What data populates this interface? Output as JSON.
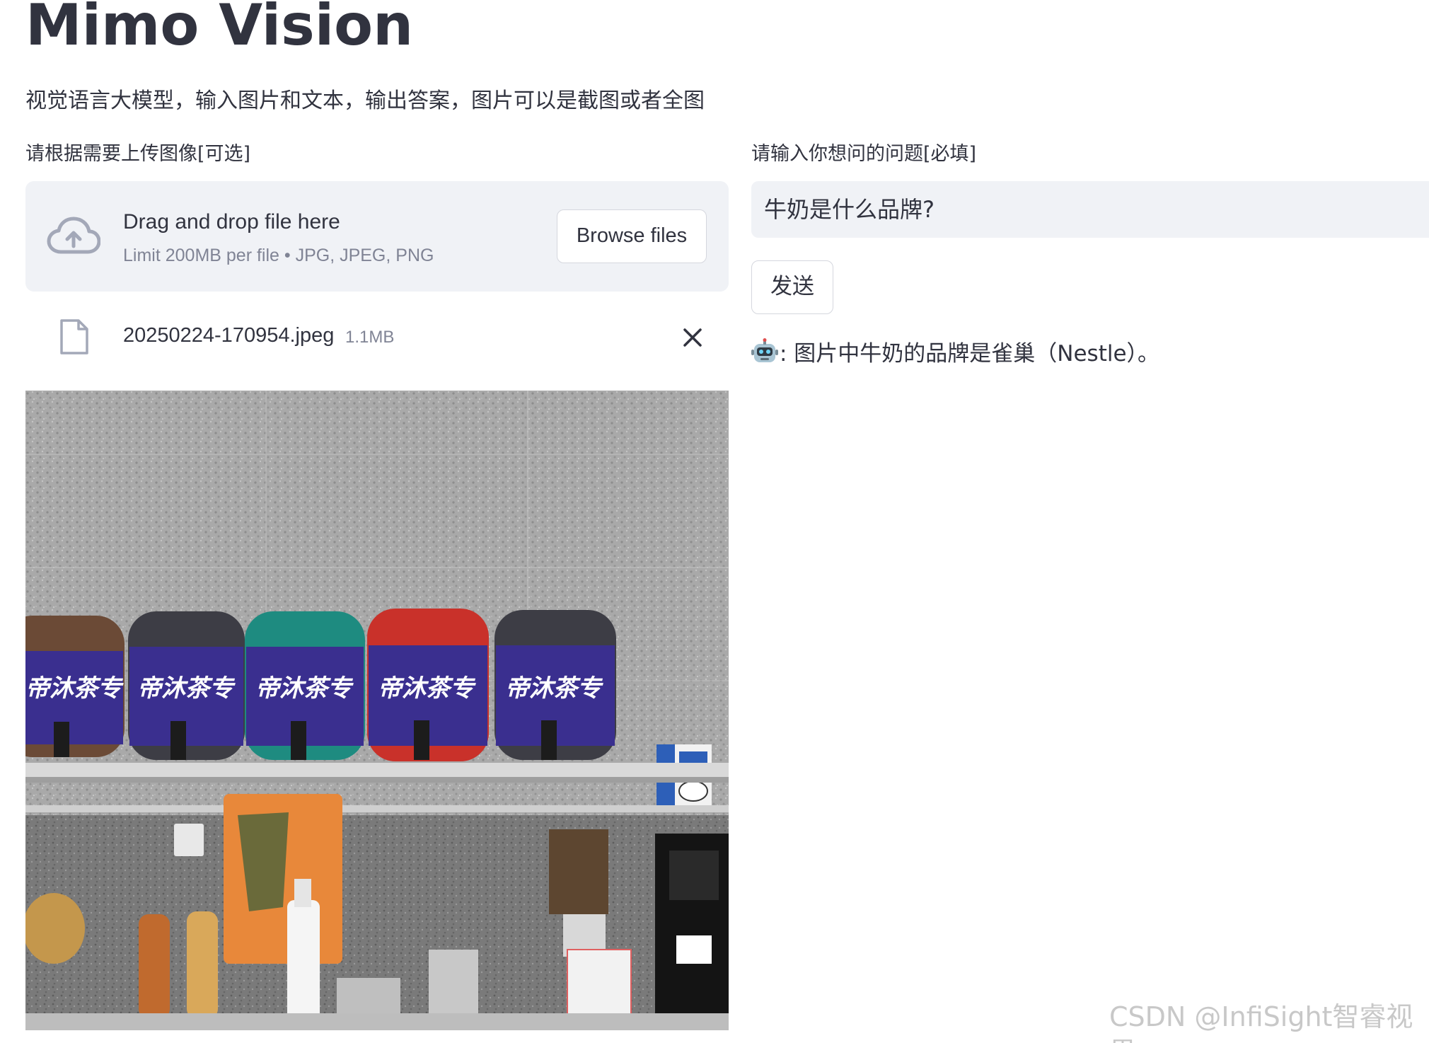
{
  "app": {
    "title": "Mimo Vision",
    "description": "视觉语言大模型，输入图片和文本，输出答案，图片可以是截图或者全图"
  },
  "uploader": {
    "label": "请根据需要上传图像[可选]",
    "drop_title": "Drag and drop file here",
    "limit_text": "Limit 200MB per file • JPG, JPEG, PNG",
    "browse_label": "Browse files",
    "icon": "cloud-upload-icon"
  },
  "uploaded_file": {
    "name": "20250224-170954.jpeg",
    "size": "1.1MB",
    "icon": "file-icon",
    "remove_icon": "close-icon",
    "preview_label": "帝沐茶专"
  },
  "question": {
    "label": "请输入你想问的问题[必填]",
    "value": "牛奶是什么品牌?",
    "send_label": "发送"
  },
  "answer": {
    "icon": "robot-icon",
    "text": ": 图片中牛奶的品牌是雀巢（Nestle）。"
  },
  "watermark": "CSDN @InfiSight智睿视界",
  "colors": {
    "text": "#31333f",
    "muted": "#808495",
    "panel": "#f0f2f6",
    "border": "#d5d7de"
  }
}
